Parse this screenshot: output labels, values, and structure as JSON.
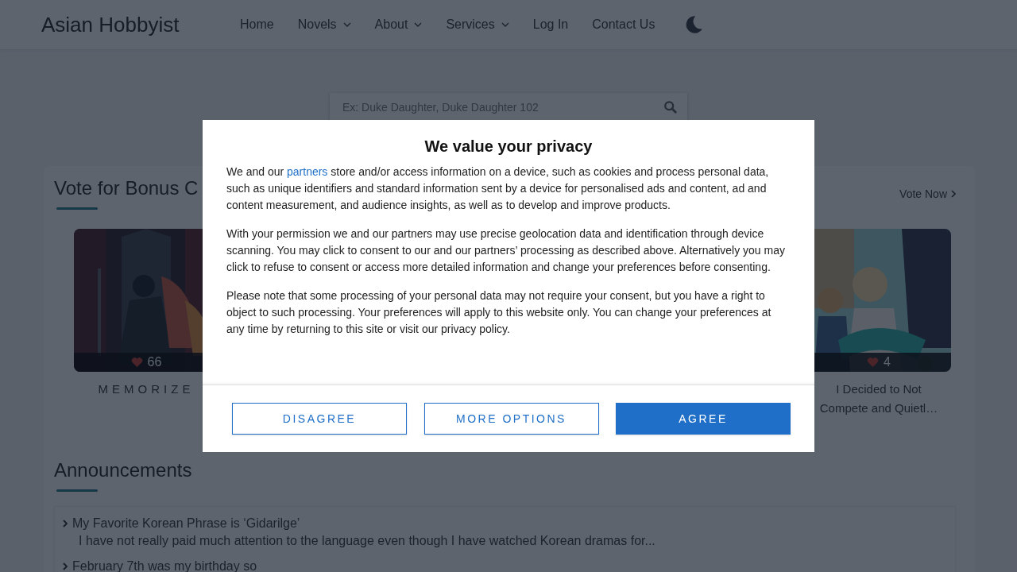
{
  "header": {
    "logo": "Asian Hobbyist",
    "nav": [
      {
        "label": "Home",
        "dropdown": false
      },
      {
        "label": "Novels",
        "dropdown": true
      },
      {
        "label": "About",
        "dropdown": true
      },
      {
        "label": "Services",
        "dropdown": true
      },
      {
        "label": "Log In",
        "dropdown": false
      },
      {
        "label": "Contact Us",
        "dropdown": false
      }
    ]
  },
  "search": {
    "placeholder": "Ex: Duke Daughter, Duke Daughter 102"
  },
  "vote": {
    "title": "Vote for Bonus C",
    "link": "Vote Now",
    "cards": [
      {
        "kind": "picture",
        "likes": "66",
        "title": "MEMORIZE",
        "spaced": true
      },
      {
        "kind": "picture",
        "likes": "4",
        "title": "I Decided to Not Compete and Quietl…",
        "spaced": false
      }
    ]
  },
  "announcements": {
    "title": "Announcements",
    "items": [
      {
        "title": "My Favorite Korean Phrase is ‘Gidarilge’",
        "excerpt": "I have not really paid much attention to the language even though I have watched Korean dramas for..."
      },
      {
        "title": "February 7th was my birthday so"
      }
    ]
  },
  "consent": {
    "title": "We value your privacy",
    "paragraphs": [
      {
        "before": "We and our",
        "link": "partners",
        "after": "store and/or access information on a device, such as cookies and process personal data, such as unique identifiers and standard information sent by a device for personalised ads and content, ad and content measurement, and audience insights, as well as to develop and improve products."
      },
      {
        "text": "With your permission we and our partners may use precise geolocation data and identification through device scanning. You may click to consent to our and our partners’ processing as described above. Alternatively you may click to refuse to consent or access more detailed information and change your preferences before consenting."
      },
      {
        "text": "Please note that some processing of your personal data may not require your consent, but you have a right to object to such processing. Your preferences will apply to this website only. You can change your preferences at any time by returning to this site or visit our privacy policy."
      }
    ],
    "buttons": [
      {
        "label": "DISAGREE",
        "primary": false
      },
      {
        "label": "MORE OPTIONS",
        "primary": false
      },
      {
        "label": "AGREE",
        "primary": true
      }
    ]
  }
}
